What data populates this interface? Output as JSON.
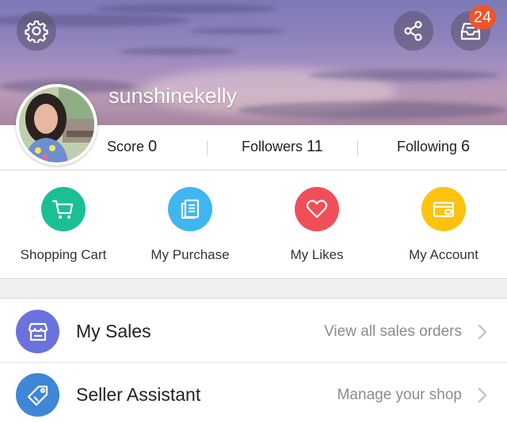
{
  "header": {
    "username": "sunshinekelly",
    "settings_icon": "gear-icon",
    "share_icon": "share-icon",
    "inbox_icon": "inbox-icon",
    "notification_count": "24"
  },
  "stats": {
    "score_label": "Score",
    "score_value": "0",
    "followers_label": "Followers",
    "followers_value": "11",
    "following_label": "Following",
    "following_value": "6"
  },
  "quick_actions": [
    {
      "label": "Shopping Cart",
      "icon": "cart-icon",
      "color": "#1bbf96"
    },
    {
      "label": "My Purchase",
      "icon": "document-icon",
      "color": "#3fb6f0"
    },
    {
      "label": "My Likes",
      "icon": "heart-icon",
      "color": "#f04f5a"
    },
    {
      "label": "My Account",
      "icon": "wallet-card-icon",
      "color": "#ffc20e"
    }
  ],
  "menu": [
    {
      "title": "My Sales",
      "subtitle": "View all sales orders",
      "icon": "store-icon",
      "color": "#6b72de"
    },
    {
      "title": "Seller Assistant",
      "subtitle": "Manage your shop",
      "icon": "tag-icon",
      "color": "#3f86d6"
    }
  ],
  "colors": {
    "badge": "#f0542a",
    "secondary_text": "#8c8c8c",
    "separator_bg": "#efefef"
  }
}
